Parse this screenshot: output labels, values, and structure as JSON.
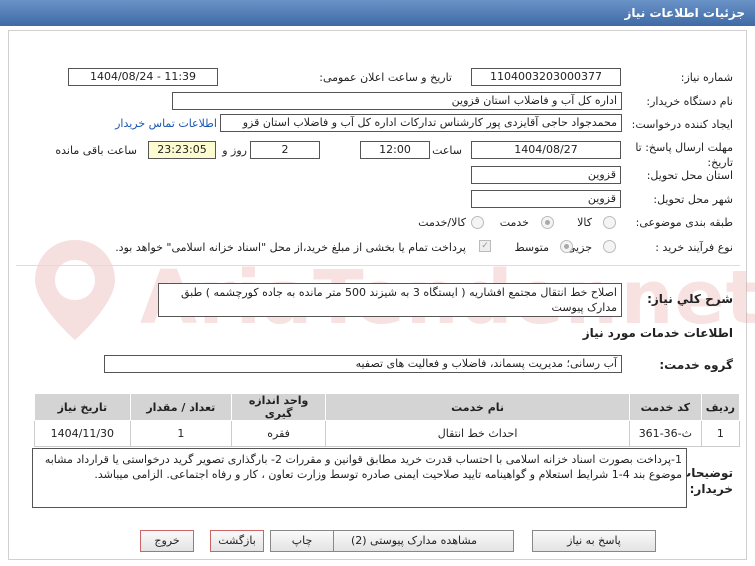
{
  "window": {
    "title": "جزئیات اطلاعات نیاز"
  },
  "labels": {
    "need_number": "شماره نیاز:",
    "announce_datetime": "تاریخ و ساعت اعلان عمومی:",
    "buyer_org": "نام دستگاه خریدار:",
    "requester": "ایجاد کننده درخواست:",
    "buyer_contact_link": "اطلاعات تماس خریدار",
    "deadline": "مهلت ارسال پاسخ: تا تاریخ:",
    "time_word": "ساعت",
    "day_and": "روز و",
    "remaining": "ساعت باقی مانده",
    "delivery_province": "استان محل تحویل:",
    "delivery_city": "شهر محل تحویل:",
    "category": "طبقه بندی موضوعی:",
    "process_type": "نوع فرآیند خرید :",
    "need_summary": "شرح کلي نياز:",
    "services_info": "اطلاعات خدمات مورد نیاز",
    "service_group": "گروه خدمت:",
    "buyer_notes": "توضیحات خریدار:"
  },
  "values": {
    "need_number": "1104003203000377",
    "announce_datetime": "1404/08/24 - 11:39",
    "buyer_org": "اداره کل آب و فاضلاب استان قزوین",
    "requester": "محمدجواد حاجی آقایزدی پور کارشناس تدارکات اداره کل آب و فاضلاب استان قزو",
    "deadline_date": "1404/08/27",
    "deadline_time": "12:00",
    "days_left": "2",
    "time_left": "23:23:05",
    "delivery_province": "قزوین",
    "delivery_city": "قزوین",
    "need_summary": "اصلاح خط انتقال مجتمع افشاریه  ( ایستگاه 3 به شیزند 500 متر مانده به جاده کورچشمه ) طبق مدارک پیوست",
    "service_group": "آب رسانی؛ مدیریت پسماند، فاضلاب و فعالیت های تصفیه",
    "buyer_notes": "1-پرداخت بصورت اسناد خزانه اسلامی با احتساب قدرت خرید مطابق قوانین و مقررات 2- بارگذاری تصویر گرید درخواستی یا قرارداد مشابه موضوع بند 4-1 شرایط استعلام و گواهینامه تایید صلاحیت ایمنی صادره توسط وزارت تعاون ، کار و رفاه اجتماعی. الزامی میباشد."
  },
  "category_options": [
    {
      "label": "کالا",
      "selected": false
    },
    {
      "label": "خدمت",
      "selected": true
    },
    {
      "label": "کالا/خدمت",
      "selected": false
    }
  ],
  "process_options": [
    {
      "label": "جزیی",
      "selected": false
    },
    {
      "label": "متوسط",
      "selected": true
    }
  ],
  "treasury_note": "پرداخت تمام یا بخشی از مبلغ خرید،از محل \"اسناد خزانه اسلامی\" خواهد بود.",
  "table": {
    "headers": [
      "ردیف",
      "کد خدمت",
      "نام خدمت",
      "واحد اندازه گیری",
      "تعداد / مقدار",
      "تاریخ نیاز"
    ],
    "rows": [
      [
        "1",
        "ث-36-361",
        "احداث خط انتقال",
        "فقره",
        "1",
        "1404/11/30"
      ]
    ]
  },
  "buttons": {
    "reply": "پاسخ به نیاز",
    "attachments": "مشاهده مدارک پیوستی (2)",
    "print": "چاپ",
    "back": "بازگشت",
    "exit": "خروج"
  },
  "watermark": "AriaTender.net",
  "colors": {
    "titlebar": "#4a76b0",
    "link": "#1a56b3",
    "exit_border": "#c66666"
  }
}
